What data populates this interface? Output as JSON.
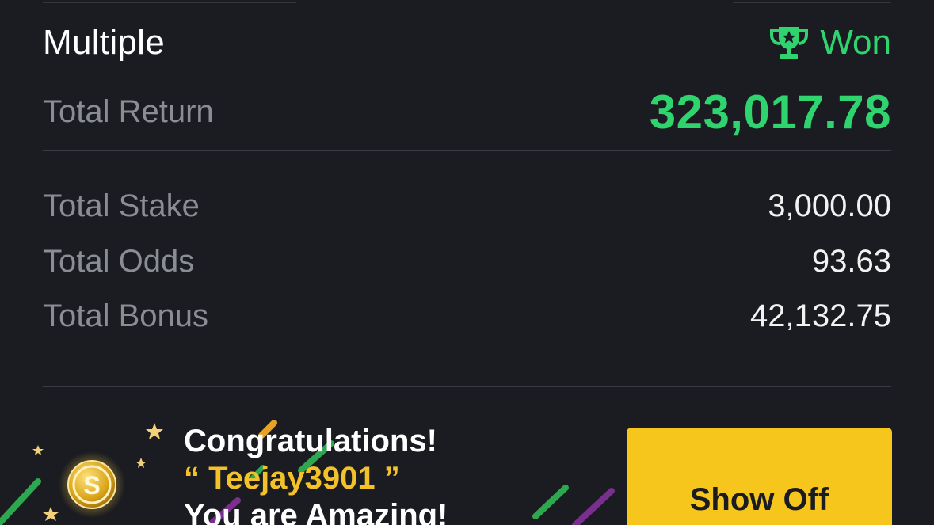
{
  "bet": {
    "type": "Multiple",
    "status": "Won",
    "status_icon": "trophy-icon",
    "status_color": "#2fd46f"
  },
  "summary": {
    "total_return_label": "Total Return",
    "total_return_value": "323,017.78",
    "total_stake_label": "Total Stake",
    "total_stake_value": "3,000.00",
    "total_odds_label": "Total Odds",
    "total_odds_value": "93.63",
    "total_bonus_label": "Total Bonus",
    "total_bonus_value": "42,132.75"
  },
  "promo": {
    "line1": "Congratulations!",
    "line2": "“ Teejay3901 ”",
    "line3": "You are Amazing!",
    "button_label": "Show Off",
    "button_color": "#f7c61c",
    "coin_icon": "coin-icon"
  }
}
